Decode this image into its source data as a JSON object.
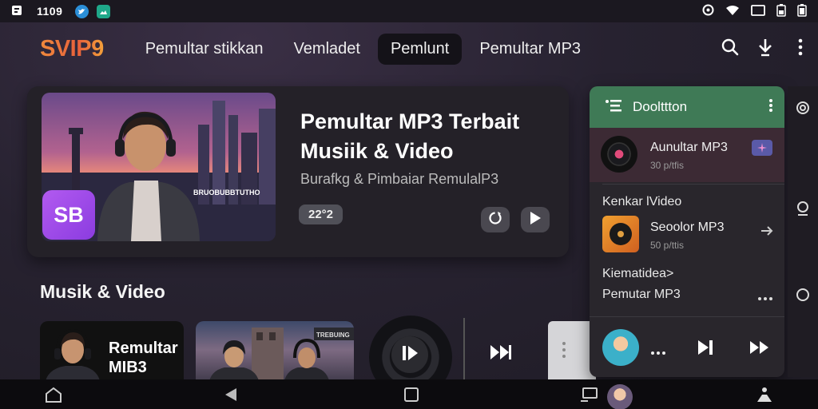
{
  "status_bar": {
    "time": "1109"
  },
  "nav": {
    "logo": "SVIP9",
    "tabs": [
      {
        "label": "Pemultar stikkan"
      },
      {
        "label": "Vemladet"
      },
      {
        "label": "Pemlunt",
        "active": true
      },
      {
        "label": "Pemultar MP3"
      }
    ]
  },
  "hero": {
    "title": "Pemultar MP3 Terbait Musiik & Video",
    "subtitle": "Burafkg & Pimbaiar RemulalP3",
    "badge": "SB",
    "overlay_text": "BRUOBUBBTUTHO",
    "count": "22°2"
  },
  "section": {
    "title": "Musik & Video",
    "thumb1_text": "Remultar MIB3",
    "thumb2_sign": "TREBUING"
  },
  "panel": {
    "title": "Doolttton",
    "now_playing": {
      "title": "Aunultar MP3",
      "meta": "30 p/tfis"
    },
    "label1": "Kenkar lVideo",
    "item2": {
      "title": "Seoolor MP3",
      "meta": "50 p/ttis"
    },
    "label2": "Kiematidea>",
    "item3": {
      "title": "Pemutar MP3"
    }
  },
  "colors": {
    "accent_green": "#3f7a56",
    "badge_purple": "#a64ae8",
    "logo_orange": "#ee7a3c"
  }
}
